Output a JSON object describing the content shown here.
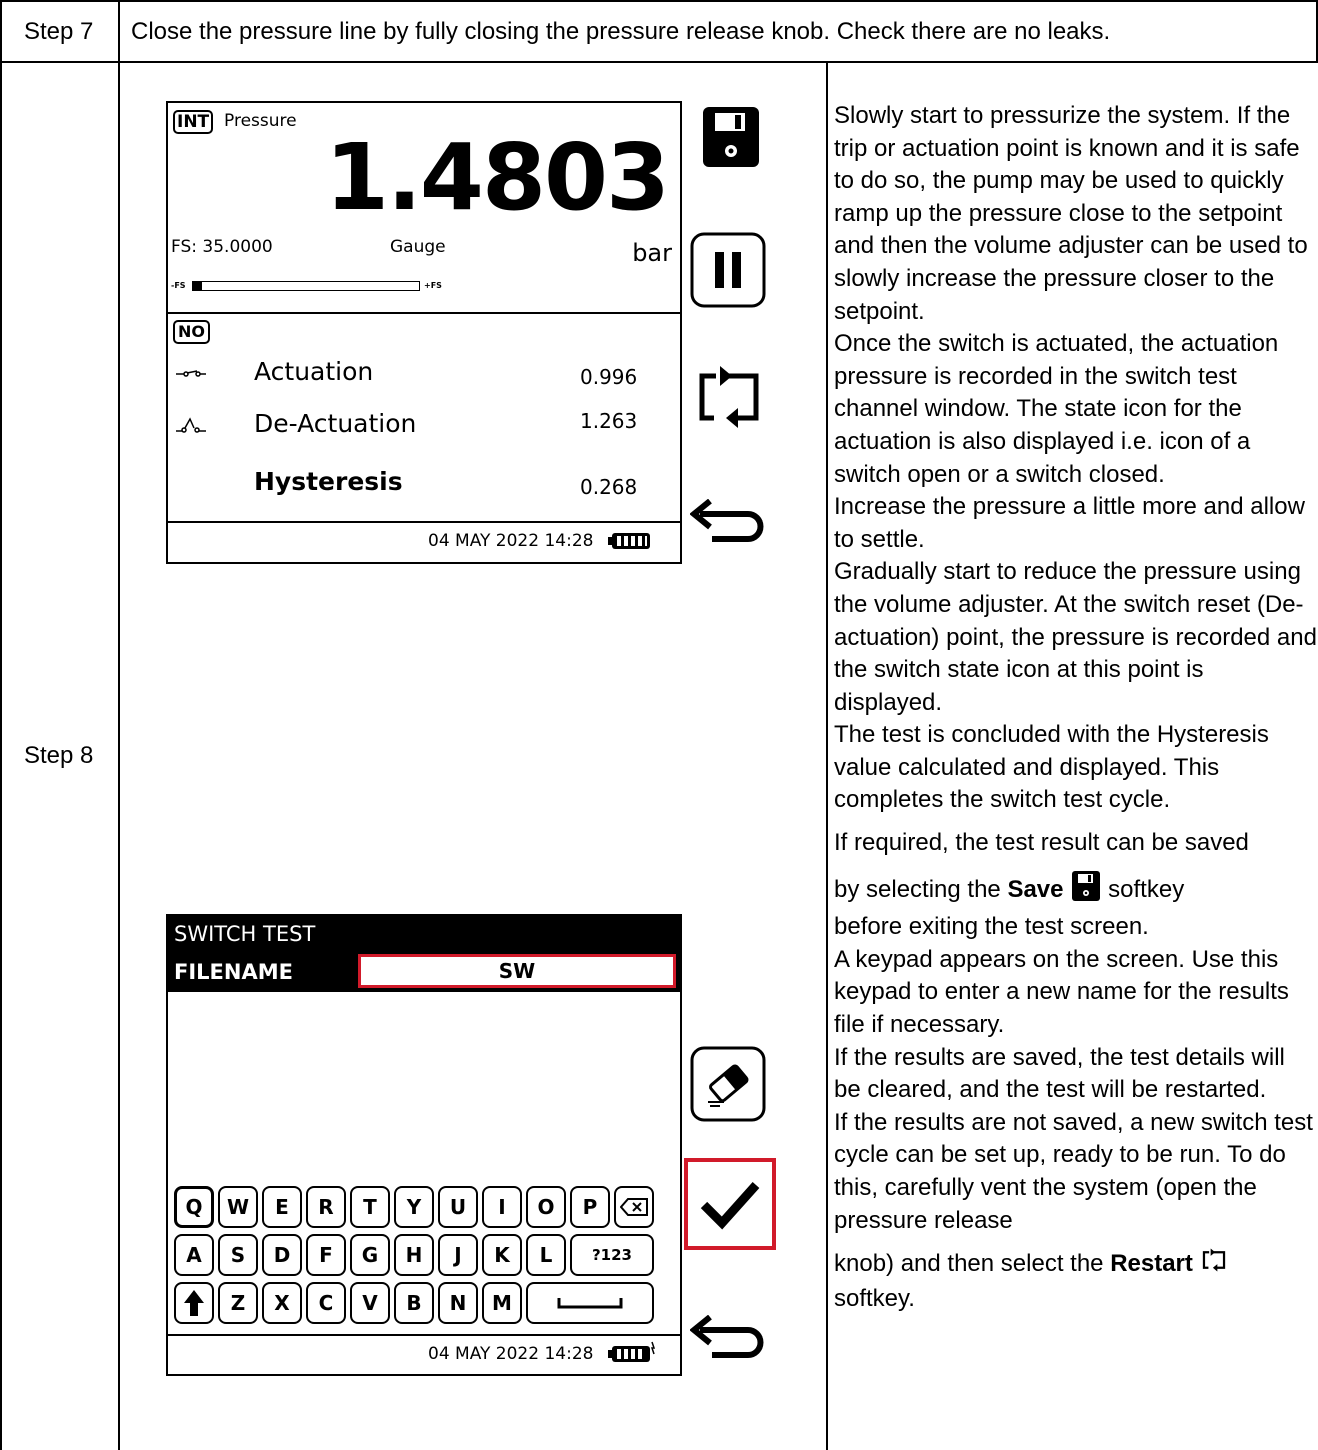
{
  "step7": {
    "label": "Step 7",
    "text": "Close the pressure line by fully closing the pressure release knob. Check there are no leaks."
  },
  "step8": {
    "label": "Step 8"
  },
  "screen1": {
    "int_tag": "INT",
    "pressure_label": "Pressure",
    "reading": "1.4803",
    "fs": "FS: 35.0000",
    "gauge": "Gauge",
    "unit": "bar",
    "bar_min": "-FS",
    "bar_max": "+FS",
    "bar_fill_fraction": 0.04,
    "no_tag": "NO",
    "actuation_label": "Actuation",
    "actuation_value": "0.996",
    "deactuation_label": "De-Actuation",
    "deactuation_value": "1.263",
    "hysteresis_label": "Hysteresis",
    "hysteresis_value": "0.268",
    "datetime": "04 MAY 2022 14:28"
  },
  "screen2": {
    "title": "SWITCH TEST",
    "filename_label": "FILENAME",
    "filename_value": "SW",
    "datetime": "04 MAY 2022 14:28",
    "row1": [
      "Q",
      "W",
      "E",
      "R",
      "T",
      "Y",
      "U",
      "I",
      "O",
      "P"
    ],
    "row2": [
      "A",
      "S",
      "D",
      "F",
      "G",
      "H",
      "J",
      "K",
      "L"
    ],
    "row2_extra": "?123",
    "row3": [
      "Z",
      "X",
      "C",
      "V",
      "B",
      "N",
      "M"
    ]
  },
  "description": {
    "p1": "Slowly start to pressurize the system. If the trip or actuation point is known and it is safe to do so, the pump may be used to quickly ramp up the pressure close to the setpoint and then the volume adjuster can be used to slowly increase the pressure closer to the setpoint.",
    "p2": "Once the switch is actuated, the actuation pressure is recorded in the switch test channel window. The state icon for the actuation is also displayed i.e. icon of a switch open or a switch closed.",
    "p3": "Increase the pressure a little more and allow to settle.",
    "p4": "Gradually start to reduce the pressure using the volume adjuster. At the switch reset (De-actuation) point, the pressure is recorded and the switch state icon at this point is displayed.",
    "p5": "The test is concluded with the Hysteresis value calculated and displayed. This completes the switch test cycle.",
    "p6": "If required, the test result can be saved",
    "p7_a": "by selecting the ",
    "p7_bold": "Save",
    "p7_b": " softkey",
    "p7_c": "before exiting the test screen.",
    "p8": "A keypad appears on the screen. Use this keypad to enter a new name for the results file if necessary.",
    "p9": "If the results are saved, the test details will be cleared, and the test will be restarted.",
    "p10": "If the results are not saved, a new switch test cycle can be set up, ready to be run. To do this, carefully vent the system (open the pressure release",
    "p11_a": "knob) and then select the ",
    "p11_bold": "Restart",
    "p11_b": "softkey."
  }
}
